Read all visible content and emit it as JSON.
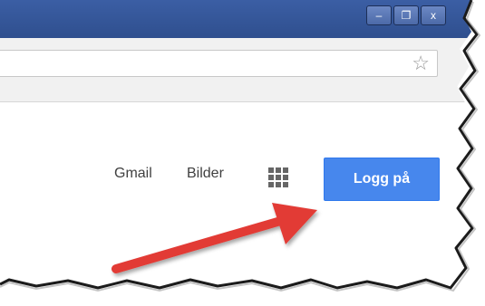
{
  "window": {
    "controls": {
      "minimize": "–",
      "restore": "❐",
      "close": "x"
    }
  },
  "toolbar": {
    "star_icon": "star-icon"
  },
  "header": {
    "links": {
      "gmail": "Gmail",
      "images": "Bilder"
    },
    "apps_icon": "apps-grid-icon",
    "login_label": "Logg på"
  },
  "colors": {
    "titlebar": "#2f4f8e",
    "login_button": "#4787ed",
    "arrow": "#e23b36"
  }
}
